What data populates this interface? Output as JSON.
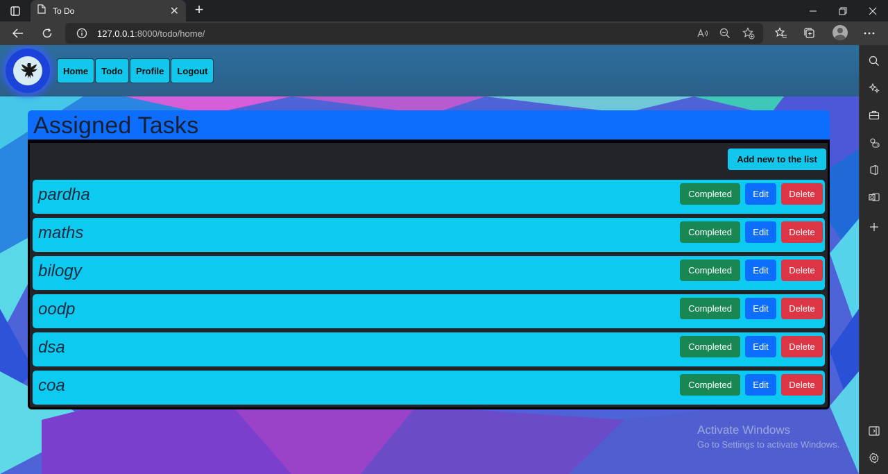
{
  "browser": {
    "tab_title": "To Do",
    "url_host": "127.0.0.1",
    "url_rest": ":8000/todo/home/"
  },
  "nav": {
    "links": [
      {
        "label": "Home"
      },
      {
        "label": "Todo"
      },
      {
        "label": "Profile"
      },
      {
        "label": "Logout"
      }
    ]
  },
  "main": {
    "title": "Assigned Tasks",
    "add_button": "Add new to the list",
    "tasks": [
      {
        "name": "pardha"
      },
      {
        "name": "maths"
      },
      {
        "name": "bilogy"
      },
      {
        "name": "oodp"
      },
      {
        "name": "dsa"
      },
      {
        "name": "coa"
      }
    ],
    "completed_label": "Completed",
    "edit_label": "Edit",
    "delete_label": "Delete"
  },
  "watermark": {
    "line1": "Activate Windows",
    "line2": "Go to Settings to activate Windows."
  },
  "colors": {
    "navbar": "#2b5f88",
    "header": "#0d6efd",
    "task": "#0dcaf0",
    "completed": "#198754",
    "edit": "#0d6efd",
    "delete": "#dc3545"
  }
}
